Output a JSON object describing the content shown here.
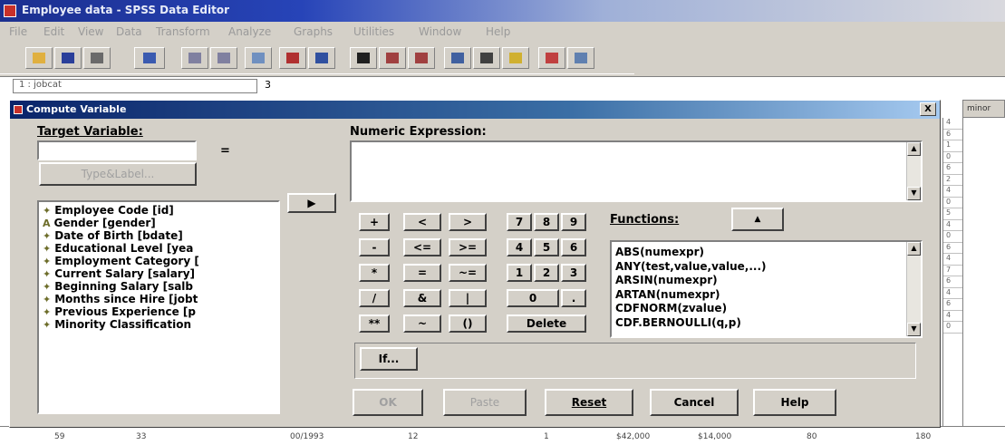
{
  "app": {
    "title": "Employee data - SPSS Data Editor",
    "menu": [
      "File",
      "Edit",
      "View",
      "Data",
      "Transform",
      "Analyze",
      "Graphs",
      "Utilities",
      "Window",
      "Help"
    ],
    "cell_ref": "1 : jobcat",
    "cell_value": "3",
    "column_header": "minor",
    "row_marks": [
      "4",
      "6",
      "1",
      "0",
      "6",
      "2",
      "4",
      "0",
      "5",
      "4",
      "0",
      "6",
      "4",
      "7",
      "6",
      "4",
      "6",
      "4",
      "0"
    ],
    "bottom_row": [
      "59",
      "33",
      "00/1993",
      "12",
      "1",
      "$42,000",
      "$14,000",
      "80",
      "180"
    ]
  },
  "dialog": {
    "title": "Compute Variable",
    "close_label": "X",
    "target_label": "Target Variable:",
    "target_value": "",
    "equals": "=",
    "type_label_button": "Type&Label...",
    "numeric_label": "Numeric Expression:",
    "expression_value": "",
    "move_arrow": "▶",
    "variables": [
      {
        "icon": "✦",
        "label": "Employee Code [id]"
      },
      {
        "icon": "A",
        "label": "Gender [gender]"
      },
      {
        "icon": "✦",
        "label": "Date of Birth [bdate]"
      },
      {
        "icon": "✦",
        "label": "Educational Level [yea"
      },
      {
        "icon": "✦",
        "label": "Employment Category ["
      },
      {
        "icon": "✦",
        "label": "Current Salary [salary]"
      },
      {
        "icon": "✦",
        "label": "Beginning Salary [salb"
      },
      {
        "icon": "✦",
        "label": "Months since Hire [jobt"
      },
      {
        "icon": "✦",
        "label": "Previous Experience [p"
      },
      {
        "icon": "✦",
        "label": "Minority Classification"
      }
    ],
    "keypad": {
      "ops": [
        [
          "+",
          "<",
          ">"
        ],
        [
          "-",
          "<=",
          ">="
        ],
        [
          "*",
          "=",
          "~="
        ],
        [
          "/",
          "&",
          "|"
        ],
        [
          "**",
          "~",
          "()"
        ]
      ],
      "digits": [
        [
          "7",
          "8",
          "9"
        ],
        [
          "4",
          "5",
          "6"
        ],
        [
          "1",
          "2",
          "3"
        ]
      ],
      "zero": "0",
      "dot": ".",
      "delete": "Delete"
    },
    "functions_label": "Functions:",
    "functions_up": "▲",
    "functions": [
      "ABS(numexpr)",
      "ANY(test,value,value,...)",
      "ARSIN(numexpr)",
      "ARTAN(numexpr)",
      "CDFNORM(zvalue)",
      "CDF.BERNOULLI(q,p)"
    ],
    "if_button": "If...",
    "buttons": {
      "ok": "OK",
      "paste": "Paste",
      "reset": "Reset",
      "cancel": "Cancel",
      "help": "Help"
    }
  }
}
